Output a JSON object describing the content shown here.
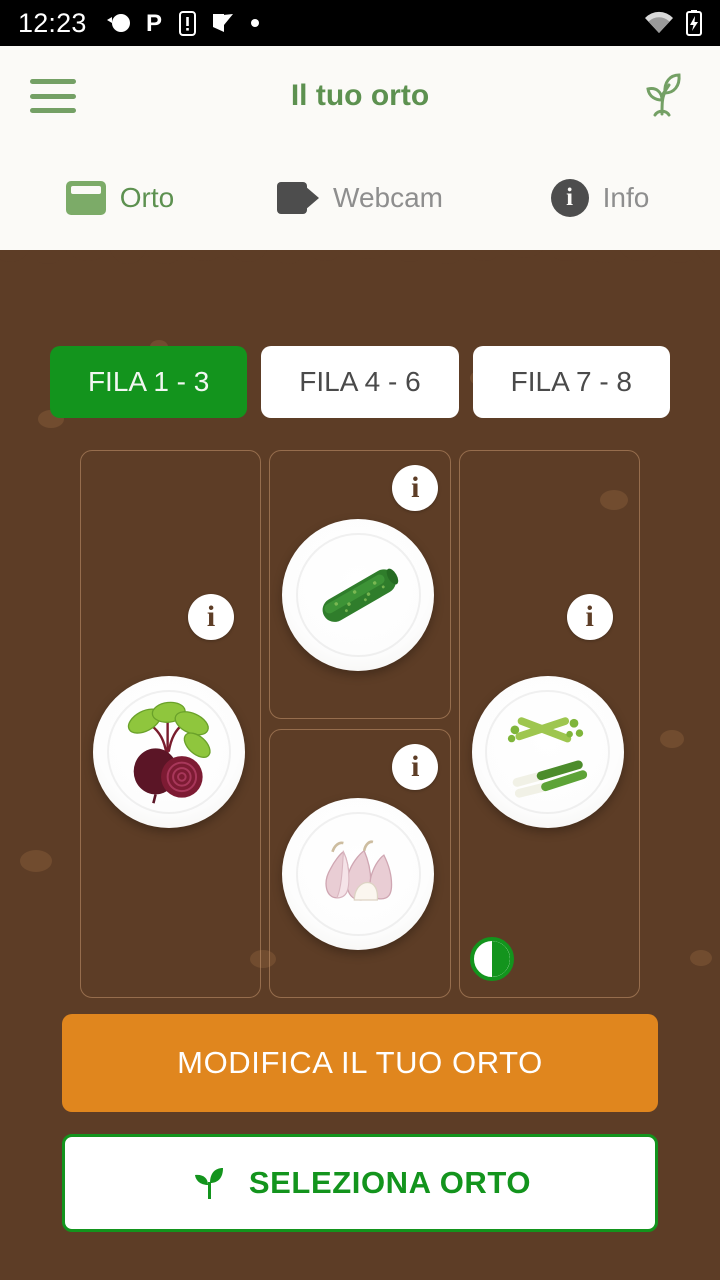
{
  "status_bar": {
    "time": "12:23",
    "left_icons": [
      "satellite-icon",
      "parking-icon",
      "phone-alert-icon",
      "checklist-icon",
      "dot-icon"
    ],
    "right_icons": [
      "wifi-icon",
      "battery-charging-icon"
    ]
  },
  "app_bar": {
    "menu_icon": "hamburger-menu-icon",
    "title": "Il tuo orto",
    "action_icon": "sprout-icon"
  },
  "tabs": [
    {
      "label": "Orto",
      "icon": "garden-bed-icon",
      "active": true
    },
    {
      "label": "Webcam",
      "icon": "video-camera-icon",
      "active": false
    },
    {
      "label": "Info",
      "icon": "info-circle-icon",
      "active": false
    }
  ],
  "row_tabs": [
    {
      "label": "FILA 1 - 3",
      "active": true
    },
    {
      "label": "FILA 4 - 6",
      "active": false
    },
    {
      "label": "FILA 7 - 8",
      "active": false
    }
  ],
  "plots": [
    {
      "id": "plot-1",
      "vegetable": "beetroot",
      "info_icon": "info-icon",
      "has_status": false
    },
    {
      "id": "plot-2",
      "vegetable": "cucumber",
      "info_icon": "info-icon",
      "has_status": false
    },
    {
      "id": "plot-3",
      "vegetable": "garlic",
      "info_icon": "info-icon",
      "has_status": false
    },
    {
      "id": "plot-4",
      "vegetable": "leek-celery",
      "info_icon": "info-icon",
      "has_status": true,
      "status_icon": "half-circle-icon"
    }
  ],
  "info_badge_label": "i",
  "buttons": {
    "edit_label": "MODIFICA IL TUO ORTO",
    "select_label": "SELEZIONA ORTO",
    "select_icon": "sprout-icon"
  },
  "colors": {
    "soil": "#5d3d26",
    "green": "#13941d",
    "header_green": "#5d9150",
    "orange": "#e0861e",
    "surface": "#fbfaf7"
  }
}
